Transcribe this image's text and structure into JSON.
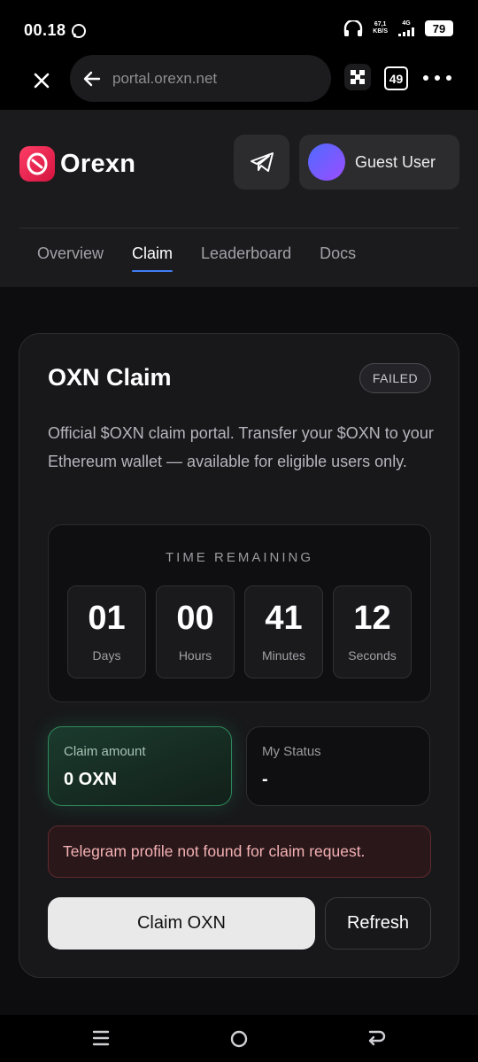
{
  "status_bar": {
    "time": "00.18",
    "net_speed_value": "67,1",
    "net_speed_unit": "KB/S",
    "net_type": "4G",
    "battery": "79"
  },
  "browser": {
    "url": "portal.orexn.net",
    "tab_count": "49"
  },
  "header": {
    "logo_text": "Orexn",
    "user_name": "Guest User",
    "nav": [
      "Overview",
      "Claim",
      "Leaderboard",
      "Docs"
    ],
    "active_nav": "Claim"
  },
  "card": {
    "title": "OXN Claim",
    "status": "FAILED",
    "description": "Official $OXN claim portal. Transfer your $OXN to your Ethereum wallet — available for eligible users only.",
    "countdown": {
      "label": "TIME REMAINING",
      "units": [
        {
          "value": "01",
          "label": "Days"
        },
        {
          "value": "00",
          "label": "Hours"
        },
        {
          "value": "41",
          "label": "Minutes"
        },
        {
          "value": "12",
          "label": "Seconds"
        }
      ]
    },
    "claim_amount": {
      "label": "Claim amount",
      "value": "0 OXN"
    },
    "my_status": {
      "label": "My Status",
      "value": "-"
    },
    "error": "Telegram profile not found for claim request.",
    "claim_button": "Claim OXN",
    "refresh_button": "Refresh"
  },
  "colors": {
    "accent": "#3f7cf5",
    "brand": "#e5234b",
    "claim_amount_border": "#2f8a5c",
    "error_text": "#f3b1b4"
  }
}
